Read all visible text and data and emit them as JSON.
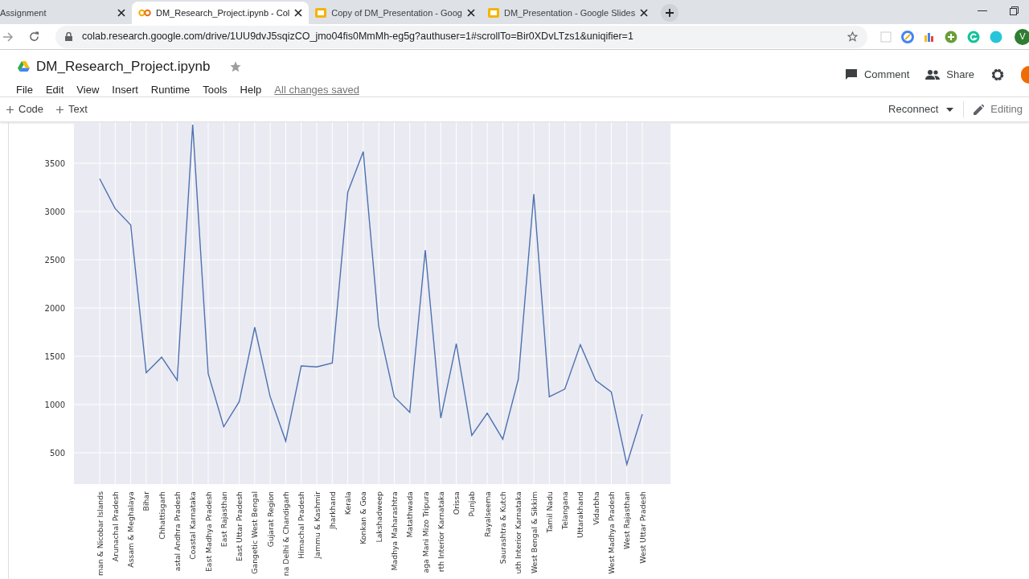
{
  "browser": {
    "tabs": [
      {
        "title": "Assignment",
        "kind": "plain",
        "selected": false
      },
      {
        "title": "DM_Research_Project.ipynb - Col",
        "kind": "colab",
        "selected": true
      },
      {
        "title": "Copy of DM_Presentation - Goog",
        "kind": "slides",
        "selected": false
      },
      {
        "title": "DM_Presentation - Google Slides",
        "kind": "slides",
        "selected": false
      }
    ],
    "url": "colab.research.google.com/drive/1UU9dvJ5sqizCO_jmo04fis0MmMh-eg5g?authuser=1#scrollTo=Bir0XDvLTzs1&uniqifier=1",
    "profile_initial": "V"
  },
  "notebook": {
    "title": "DM_Research_Project.ipynb",
    "menu": [
      "File",
      "Edit",
      "View",
      "Insert",
      "Runtime",
      "Tools",
      "Help"
    ],
    "save_status": "All changes saved",
    "actions": [
      {
        "label": "Comment",
        "kind": "comment"
      },
      {
        "label": "Share",
        "kind": "share"
      }
    ],
    "toolbar": [
      "Code",
      "Text"
    ],
    "connect": "Reconnect",
    "mode": "Editing"
  },
  "chart": {
    "chart_data": {
      "type": "line",
      "categories": [
        "man & Nicobar Islands",
        "Arunachal Pradesh",
        "Assam & Meghalaya",
        "Bihar",
        "Chhattisgarh",
        "astal Andhra Pradesh",
        "Coastal Karnataka",
        "East Madhya Pradesh",
        "East Rajasthan",
        "East Uttar Pradesh",
        "Gangetic West Bengal",
        "Gujarat Region",
        "na Delhi & Chandigarh",
        "Himachal Pradesh",
        "Jammu & Kashmir",
        "Jharkhand",
        "Kerala",
        "Konkan & Goa",
        "Lakshadweep",
        "Madhya Maharashtra",
        "Matathwada",
        "aga Mani Mizo Tripura",
        "rth Interior Karnataka",
        "Orissa",
        "Punjab",
        "Rayalseema",
        "Saurashtra & Kutch",
        "uth Interior Karnataka",
        "West Bengal & Sikkim",
        "Tamil Nadu",
        "Telangana",
        "Uttarakhand",
        "Vidarbha",
        "West Madhya Pradesh",
        "West Rajasthan",
        "West Uttar Pradesh"
      ],
      "series": [
        {
          "color": "#4c72b0",
          "values": [
            3340,
            3030,
            2860,
            1330,
            1490,
            1250,
            3900,
            1320,
            770,
            1030,
            1800,
            1080,
            620,
            1400,
            1390,
            1430,
            3200,
            3620,
            1810,
            1080,
            920,
            2600,
            860,
            1630,
            680,
            910,
            640,
            1260,
            3180,
            1080,
            1160,
            1620,
            1250,
            1130,
            380,
            900
          ]
        }
      ],
      "grid": true,
      "ylim": [
        175,
        3925
      ],
      "yticks": [
        500,
        1000,
        1500,
        2000,
        2500,
        3000,
        3500
      ]
    }
  }
}
